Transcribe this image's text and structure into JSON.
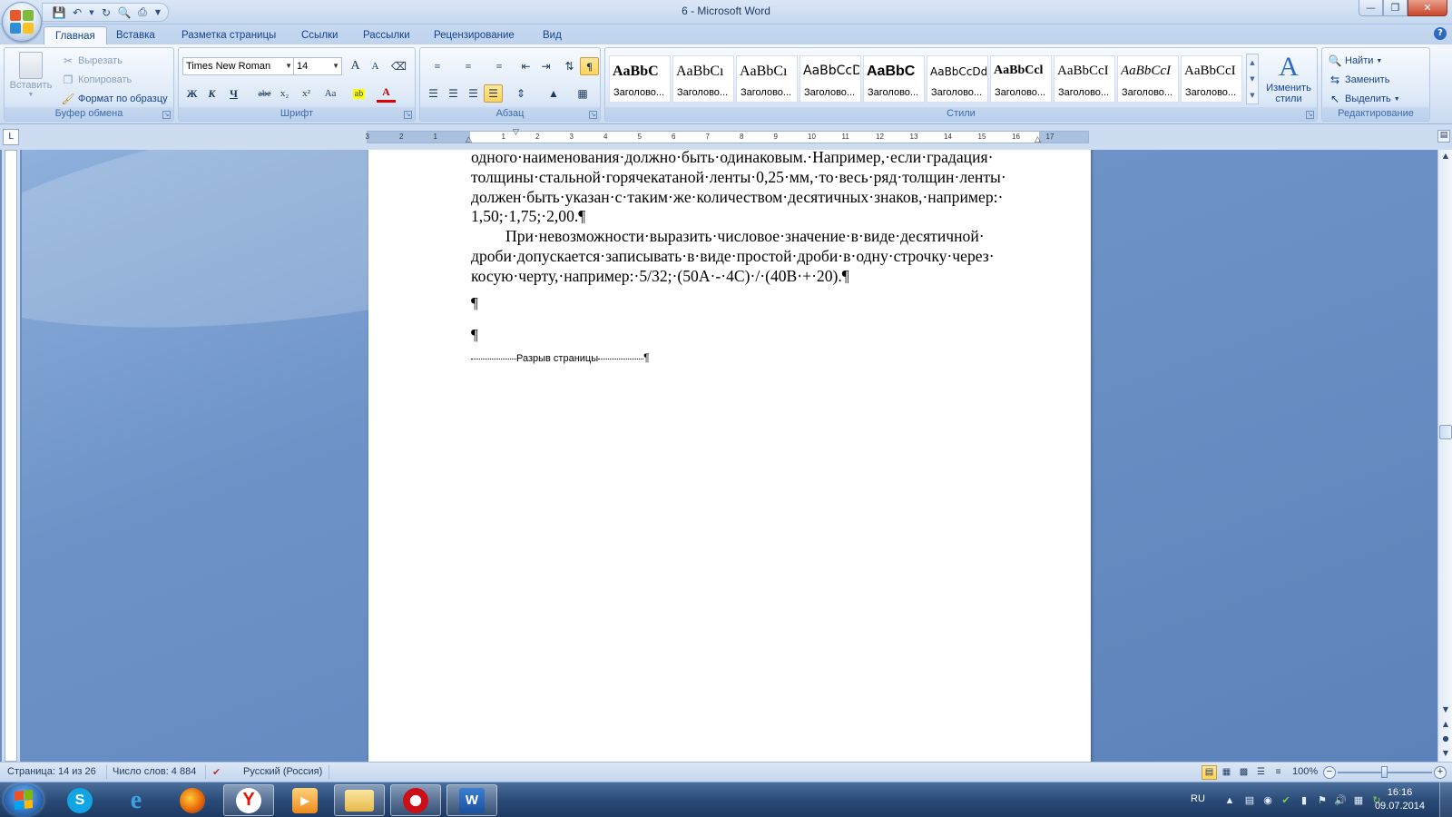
{
  "app": {
    "title": "6 - Microsoft Word",
    "colors": {
      "accent": "#15428b",
      "ribbon_bg": "#dce8f6",
      "workspace_bg": "#6d93c8",
      "highlight": "#ffd457"
    }
  },
  "quick_access": {
    "icons": [
      "save-icon",
      "undo-icon",
      "redo-icon",
      "print-preview-icon",
      "quick-print-icon",
      "customize-icon"
    ]
  },
  "tabs": [
    {
      "label": "Главная",
      "active": true
    },
    {
      "label": "Вставка"
    },
    {
      "label": "Разметка страницы"
    },
    {
      "label": "Ссылки"
    },
    {
      "label": "Рассылки"
    },
    {
      "label": "Рецензирование"
    },
    {
      "label": "Вид"
    }
  ],
  "ribbon": {
    "clipboard": {
      "label": "Буфер обмена",
      "paste": "Вставить",
      "cut": "Вырезать",
      "copy": "Копировать",
      "format_painter": "Формат по образцу"
    },
    "font": {
      "label": "Шрифт",
      "font_name": "Times New Roman",
      "font_size": "14",
      "grow": "A",
      "shrink": "A",
      "bold": "Ж",
      "italic": "К",
      "underline": "Ч",
      "strike": "abe",
      "subscript": "x₂",
      "superscript": "x²",
      "change_case": "Aa",
      "font_color": "A"
    },
    "paragraph": {
      "label": "Абзац",
      "show_marks": "¶",
      "show_marks_on": true
    },
    "styles": {
      "label": "Стили",
      "change_styles_line1": "Изменить",
      "change_styles_line2": "стили",
      "tiles": [
        {
          "sample": "AaBbC",
          "name": "Заголово..."
        },
        {
          "sample": "AaBbCı",
          "name": "Заголово..."
        },
        {
          "sample": "AaBbCı",
          "name": "Заголово..."
        },
        {
          "sample": "AaBbCcD",
          "name": "Заголово..."
        },
        {
          "sample": "AaBbC",
          "name": "Заголово..."
        },
        {
          "sample": "AaBbCcDd",
          "name": "Заголово..."
        },
        {
          "sample": "AaBbCcl",
          "name": "Заголово..."
        },
        {
          "sample": "AaBbCcI",
          "name": "Заголово..."
        },
        {
          "sample": "AaBbCcI",
          "name": "Заголово..."
        },
        {
          "sample": "AaBbCcI",
          "name": "Заголово..."
        }
      ]
    },
    "editing": {
      "label": "Редактирование",
      "find": "Найти",
      "replace": "Заменить",
      "select": "Выделить"
    }
  },
  "ruler": {
    "ticks": [
      "3",
      "2",
      "1",
      "1",
      "2",
      "3",
      "4",
      "5",
      "6",
      "7",
      "8",
      "9",
      "10",
      "11",
      "12",
      "13",
      "14",
      "15",
      "16",
      "17"
    ]
  },
  "document": {
    "paragraphs": [
      "одного·наименования·должно·быть·одинаковым.·Например,·если·градация· толщины·стальной·горячекатаной·ленты·0,25·мм,·то·весь·ряд·толщин·ленты· должен·быть·указан·с·таким·же·количеством·десятичных·знаков,·например:· 1,50;·1,75;·2,00.¶",
      "При·невозможности·выразить·числовое·значение·в·виде·десятичной· дроби·допускается·записывать·в·виде·простой·дроби·в·одну·строчку·через· косую·черту,·например:·5/32;·(50А·-·4С)·/·(40В·+·20).¶"
    ],
    "empty_mark_1": "¶",
    "empty_mark_2": "¶",
    "page_break_label": "Разрыв страницы",
    "page_break_mark": "¶"
  },
  "status": {
    "page": "Страница: 14 из 26",
    "words": "Число слов: 4 884",
    "language": "Русский (Россия)",
    "zoom": "100%",
    "zoom_level": 1.0
  },
  "taskbar": {
    "apps": [
      {
        "name": "skype",
        "icon": "skype-icon"
      },
      {
        "name": "internet-explorer",
        "icon": "ie-icon"
      },
      {
        "name": "firefox",
        "icon": "firefox-icon"
      },
      {
        "name": "yandex",
        "icon": "yandex-icon"
      },
      {
        "name": "media-player",
        "icon": "media-icon"
      },
      {
        "name": "explorer",
        "icon": "folder-icon"
      },
      {
        "name": "opera",
        "icon": "opera-icon"
      },
      {
        "name": "word",
        "icon": "word-icon"
      }
    ],
    "lang": "RU",
    "time": "16:16",
    "date": "09.07.2014"
  }
}
